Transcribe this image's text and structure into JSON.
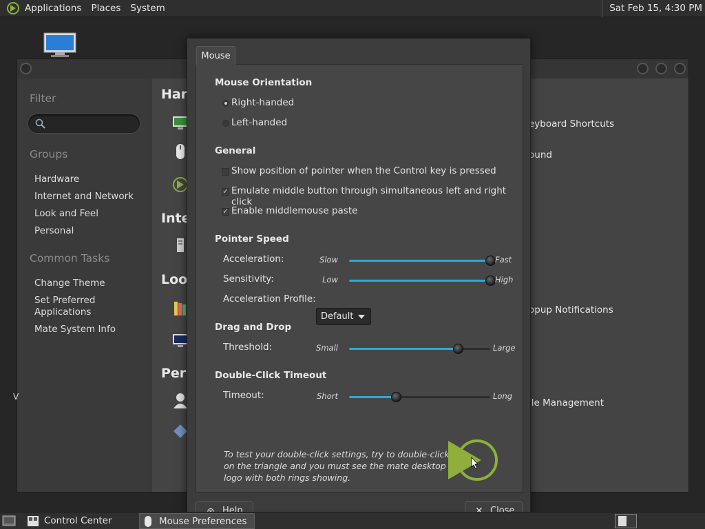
{
  "top_panel": {
    "menus": [
      "Applications",
      "Places",
      "System"
    ],
    "clock": "Sat Feb 15,  4:30 PM"
  },
  "control_center": {
    "sidebar": {
      "filter_label": "Filter",
      "groups_label": "Groups",
      "groups": [
        "Hardware",
        "Internet and Network",
        "Look and Feel",
        "Personal"
      ],
      "common_tasks_label": "Common Tasks",
      "tasks": [
        "Change Theme",
        "Set Preferred Applications",
        "Mate System Info"
      ]
    },
    "categories": [
      "Hard",
      "Inter",
      "Look",
      "Pers"
    ],
    "visible_items": [
      "eyboard Shortcuts",
      "ound",
      "opup Notifications",
      "ile Management"
    ],
    "stray_char": "V"
  },
  "dialog": {
    "tab": "Mouse",
    "orientation": {
      "title": "Mouse Orientation",
      "options": [
        "Right-handed",
        "Left-handed"
      ],
      "selected": "Right-handed"
    },
    "general": {
      "title": "General",
      "checks": [
        {
          "label": "Show position of pointer when the Control key is pressed",
          "checked": false
        },
        {
          "label": "Emulate middle button through simultaneous left and right click",
          "checked": true
        },
        {
          "label": "Enable middlemouse paste",
          "checked": true
        }
      ]
    },
    "pointer_speed": {
      "title": "Pointer Speed",
      "acceleration": {
        "label": "Acceleration:",
        "min": "Slow",
        "max": "Fast",
        "fraction": 1.0
      },
      "sensitivity": {
        "label": "Sensitivity:",
        "min": "Low",
        "max": "High",
        "fraction": 1.0
      },
      "profile": {
        "label": "Acceleration Profile:",
        "value": "Default"
      }
    },
    "drag_drop": {
      "title": "Drag and Drop",
      "threshold": {
        "label": "Threshold:",
        "min": "Small",
        "max": "Large",
        "fraction": 0.77
      }
    },
    "double_click": {
      "title": "Double-Click Timeout",
      "timeout": {
        "label": "Timeout:",
        "min": "Short",
        "max": "Long",
        "fraction": 0.33
      },
      "test_text": "To test your double-click settings, try to double-click on the triangle and you must see the mate desktop logo with both rings showing."
    },
    "buttons": {
      "help": "Help",
      "close": "Close"
    }
  },
  "taskbar": {
    "tasks": [
      "Control Center",
      "Mouse Preferences"
    ],
    "active": "Mouse Preferences"
  },
  "colors": {
    "accent": "#2fa8d8",
    "logo_green": "#8fae3c"
  }
}
